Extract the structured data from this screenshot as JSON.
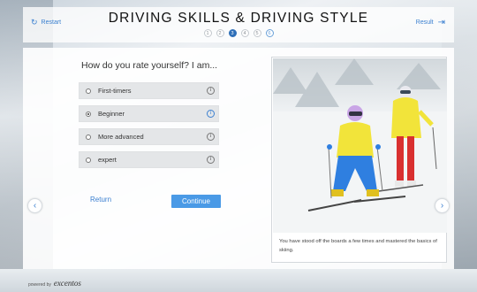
{
  "header": {
    "restart_label": "Restart",
    "result_label": "Result",
    "title": "DRIVING SKILLS & DRIVING STYLE",
    "steps": [
      "1",
      "2",
      "3",
      "4",
      "5",
      "6"
    ],
    "active_step": 3
  },
  "question": "How do you rate yourself? I am...",
  "options": [
    {
      "label": "First-timers",
      "selected": false
    },
    {
      "label": "Beginner",
      "selected": true
    },
    {
      "label": "More advanced",
      "selected": false
    },
    {
      "label": "expert",
      "selected": false
    }
  ],
  "buttons": {
    "return_label": "Return",
    "continue_label": "Continue"
  },
  "card": {
    "caption": "You have stood off the boards a few times and mastered the basics of skiing."
  },
  "footer": {
    "powered_by": "powered by",
    "brand": "excentos"
  },
  "colors": {
    "accent": "#3a7fd0",
    "continue_bg": "#4a9ae6",
    "step_active": "#2e6fb8"
  }
}
